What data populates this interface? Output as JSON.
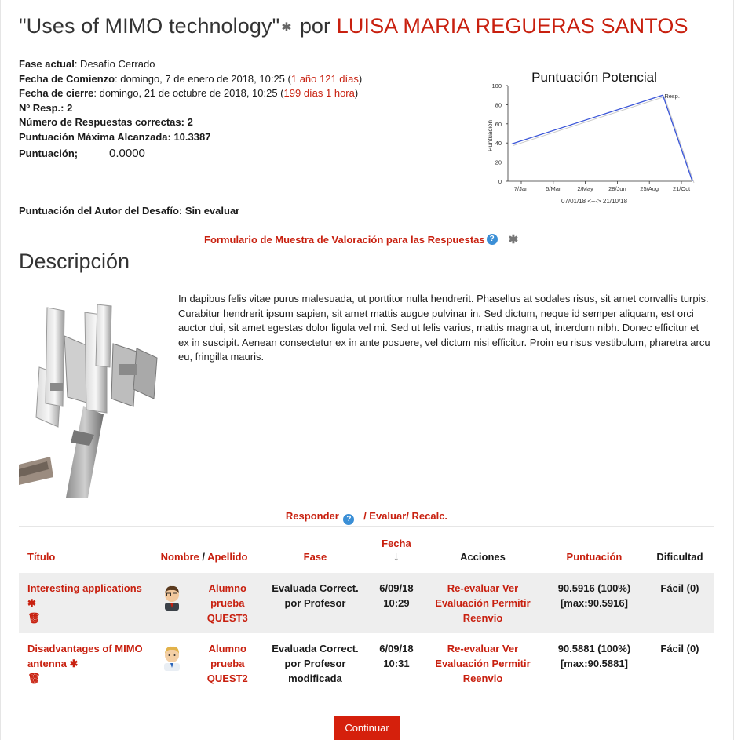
{
  "header": {
    "title": "\"Uses of MIMO technology\"",
    "by": "por",
    "author": "LUISA MARIA REGUERAS SANTOS"
  },
  "info": {
    "phase_label": "Fase actual",
    "phase_value": ": Desafío Cerrado",
    "start_label": "Fecha de Comienzo",
    "start_value": ": domingo, 7 de enero de 2018, 10:25 (",
    "start_ago": "1 año 121 días",
    "close_label": "Fecha de cierre",
    "close_value": ": domingo, 21 de octubre de 2018, 10:25 (",
    "close_ago": "199 días 1 hora",
    "num_resp": "Nº Resp.: 2",
    "correct": "Número de Respuestas correctas: 2",
    "max_score": "Puntuación Máxima Alcanzada: 10.3387",
    "score_label": "Puntuación;",
    "score_value": "0.0000",
    "author_score": "Puntuación del Autor del Desafío: Sin evaluar"
  },
  "form_link": "Formulario de Muestra de Valoración para las Respuestas",
  "description": {
    "heading": "Descripción",
    "text": "In dapibus felis vitae purus malesuada, ut porttitor nulla hendrerit. Phasellus at sodales risus, sit amet convallis turpis. Curabitur hendrerit ipsum sapien, sit amet mattis augue pulvinar in. Sed dictum, neque id semper aliquam, est orci auctor dui, sit amet egestas dolor ligula vel mi. Sed ut felis varius, mattis magna ut, interdum nibh. Donec efficitur et ex in suscipit. Aenean consectetur ex in ante posuere, vel dictum nisi efficitur. Proin eu risus vestibulum, pharetra arcu eu, fringilla mauris."
  },
  "actions_bar": {
    "respond": "Responder",
    "evaluate": "/ Evaluar/",
    "recalc": "Recalc."
  },
  "table": {
    "headers": {
      "title": "Título",
      "name": "Nombre",
      "sep": "/",
      "surname": "Apellido",
      "phase": "Fase",
      "date": "Fecha",
      "actions": "Acciones",
      "score": "Puntuación",
      "difficulty": "Dificultad"
    },
    "rows": [
      {
        "title": "Interesting applications",
        "name": "Alumno prueba QUEST3",
        "phase": "Evaluada Correct. por Profesor",
        "date": "6/09/18 10:29",
        "actions": "Re-evaluar Ver Evaluación Permitir Reenvio",
        "score": "90.5916 (100%) [max:90.5916]",
        "difficulty": "Fácil (0)"
      },
      {
        "title": "Disadvantages of MIMO antenna",
        "name": "Alumno prueba QUEST2",
        "phase": "Evaluada Correct. por Profesor modificada",
        "date": "6/09/18 10:31",
        "actions": "Re-evaluar Ver Evaluación Permitir Reenvio",
        "score": "90.5881 (100%) [max:90.5881]",
        "difficulty": "Fácil (0)"
      }
    ]
  },
  "continue_label": "Continuar",
  "colors": {
    "accent": "#c8200f",
    "button": "#d5200c",
    "row_shade": "#eeeeee",
    "series": "#3a55d8"
  },
  "chart_data": {
    "type": "line",
    "title": "Puntuación Potencial",
    "ylabel": "Puntuación",
    "xlabel": "07/01/18 <---> 21/10/18",
    "ylim": [
      0,
      100
    ],
    "yticks": [
      0,
      20,
      40,
      60,
      80,
      100
    ],
    "xtick_labels": [
      "7/Jan",
      "5/Mar",
      "2/May",
      "28/Jun",
      "25/Aug",
      "21/Oct"
    ],
    "series": [
      {
        "name": "Resp.",
        "x": [
          "2018-01-13",
          "2018-09-05",
          "2018-10-21"
        ],
        "y": [
          39,
          90,
          0
        ]
      }
    ],
    "legend": "top-right",
    "grid": false
  }
}
